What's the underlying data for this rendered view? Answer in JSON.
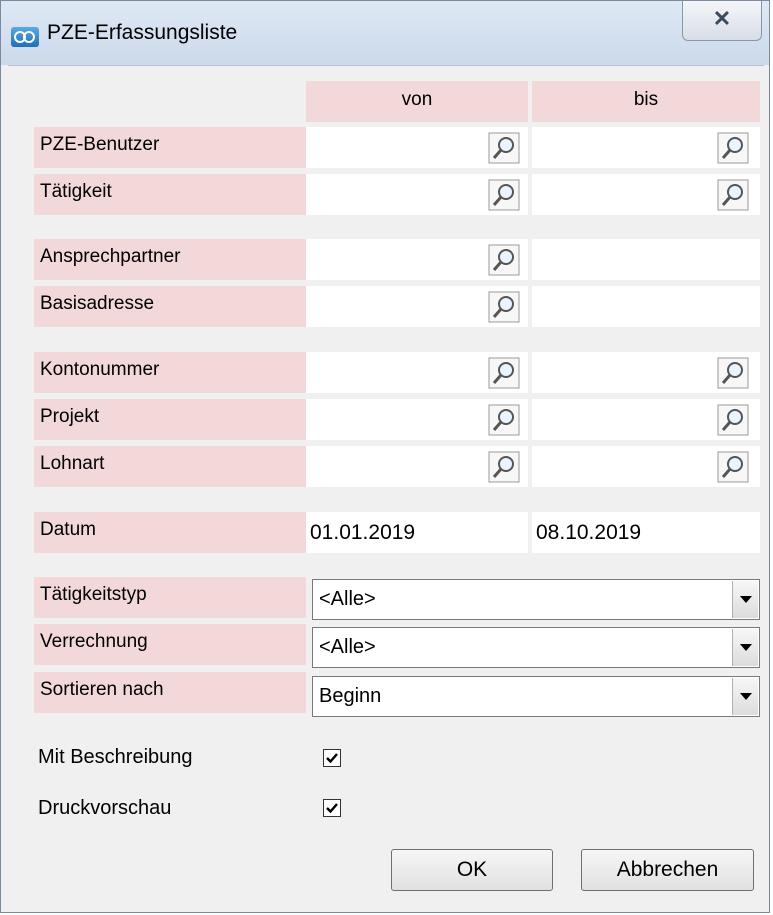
{
  "window": {
    "title": "PZE-Erfassungsliste",
    "close_glyph": "✕"
  },
  "columns": {
    "from": "von",
    "to": "bis"
  },
  "rows": [
    {
      "label": "PZE-Benutzer",
      "von": "",
      "bis": ""
    },
    {
      "label": "Tätigkeit",
      "von": "",
      "bis": ""
    },
    {
      "label": "Ansprechpartner",
      "von": ""
    },
    {
      "label": "Basisadresse",
      "von": ""
    },
    {
      "label": "Kontonummer",
      "von": "",
      "bis": ""
    },
    {
      "label": "Projekt",
      "von": "",
      "bis": ""
    },
    {
      "label": "Lohnart",
      "von": "",
      "bis": ""
    }
  ],
  "date": {
    "label": "Datum",
    "von": "01.01.2019",
    "bis": "08.10.2019"
  },
  "selects": [
    {
      "label": "Tätigkeitstyp",
      "value": "<Alle>"
    },
    {
      "label": "Verrechnung",
      "value": "<Alle>"
    },
    {
      "label": "Sortieren nach",
      "value": "Beginn"
    }
  ],
  "checkboxes": [
    {
      "label": "Mit Beschreibung",
      "checked": true
    },
    {
      "label": "Druckvorschau",
      "checked": true
    }
  ],
  "buttons": {
    "ok": "OK",
    "cancel": "Abbrechen"
  },
  "icons": {
    "lookup": "magnifier-lookup-icon",
    "dropdown": "chevron-down-icon",
    "check": "checkmark-icon"
  },
  "colors": {
    "label_bg": "#f2d8d8",
    "window_bg": "#f0f0f0",
    "field_bg": "#ffffff"
  }
}
